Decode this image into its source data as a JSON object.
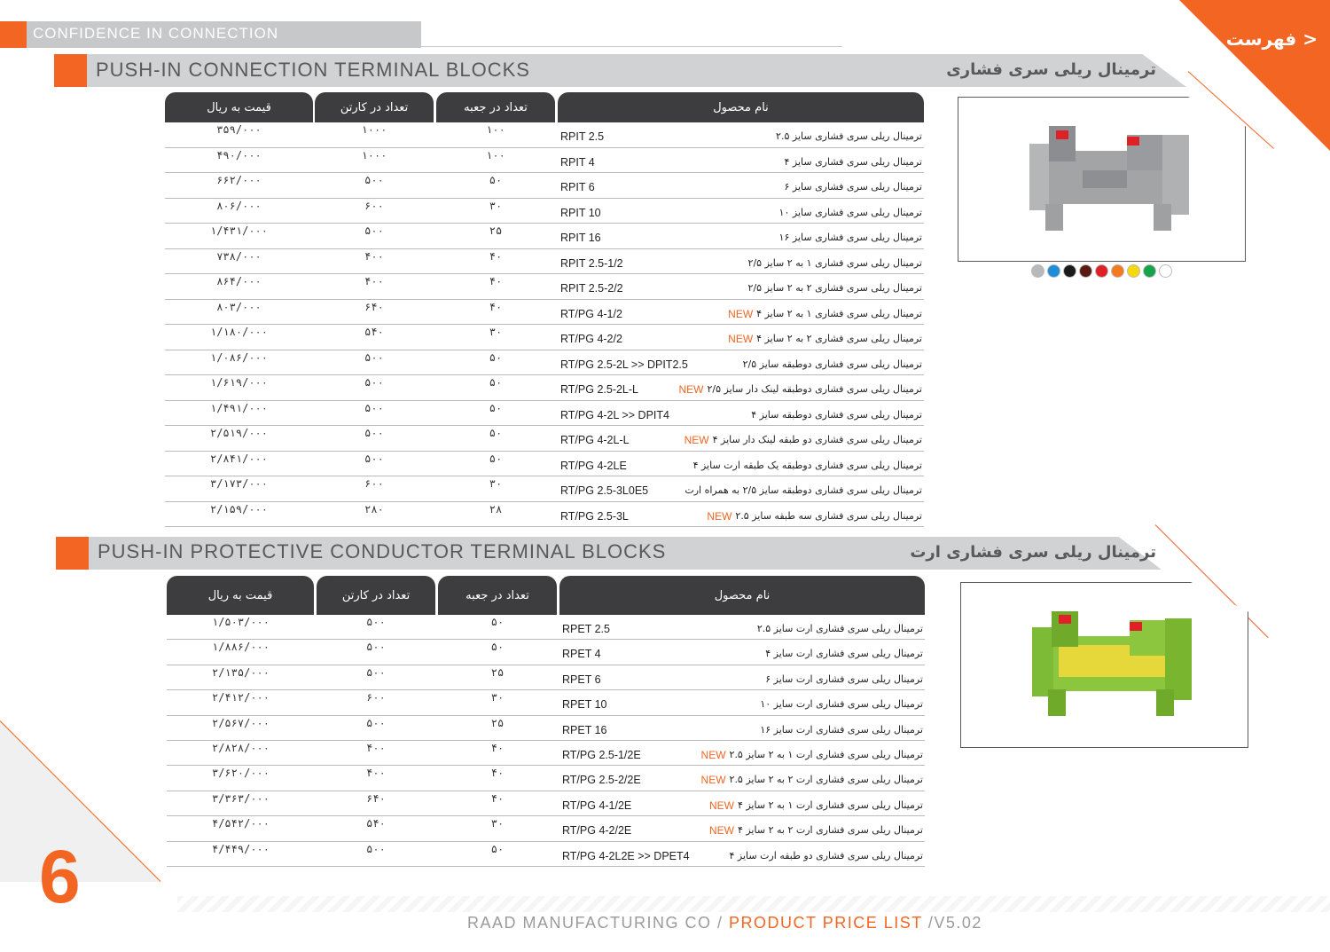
{
  "header": {
    "tagline": "CONFIDENCE IN CONNECTION",
    "menu_link": "< فهرست"
  },
  "section1": {
    "title_en": "PUSH-IN CONNECTION TERMINAL BLOCKS",
    "title_fa": "ترمینال ریلی سری فشاری",
    "columns": {
      "price": "قیمت به ریال",
      "carton": "تعداد در کارتن",
      "box": "تعداد در جعبه",
      "name": "نام محصول"
    },
    "rows": [
      {
        "price": "۳۵۹/۰۰۰",
        "carton": "۱۰۰۰",
        "box": "۱۰۰",
        "model": "RPIT  2.5",
        "name": "ترمینال ریلی سری فشاری سایز ۲.۵",
        "new": ""
      },
      {
        "price": "۴۹۰/۰۰۰",
        "carton": "۱۰۰۰",
        "box": "۱۰۰",
        "model": "RPIT  4",
        "name": "ترمینال ریلی سری فشاری سایز ۴",
        "new": ""
      },
      {
        "price": "۶۶۲/۰۰۰",
        "carton": "۵۰۰",
        "box": "۵۰",
        "model": "RPIT  6",
        "name": "ترمینال ریلی سری فشاری سایز ۶",
        "new": ""
      },
      {
        "price": "۸۰۶/۰۰۰",
        "carton": "۶۰۰",
        "box": "۳۰",
        "model": "RPIT 10",
        "name": "ترمینال ریلی سری فشاری سایز ۱۰",
        "new": ""
      },
      {
        "price": "۱/۴۳۱/۰۰۰",
        "carton": "۵۰۰",
        "box": "۲۵",
        "model": "RPIT  16",
        "name": "ترمینال ریلی سری فشاری سایز ۱۶",
        "new": ""
      },
      {
        "price": "۷۳۸/۰۰۰",
        "carton": "۴۰۰",
        "box": "۴۰",
        "model": "RPIT  2.5-1/2",
        "name": "ترمینال ریلی سری فشاری ۱ به ۲ سایز ۲/۵",
        "new": ""
      },
      {
        "price": "۸۶۴/۰۰۰",
        "carton": "۴۰۰",
        "box": "۴۰",
        "model": "RPIT  2.5-2/2",
        "name": "ترمینال ریلی سری فشاری ۲ به ۲ سایز ۲/۵",
        "new": ""
      },
      {
        "price": "۸۰۳/۰۰۰",
        "carton": "۶۴۰",
        "box": "۴۰",
        "model": "RT/PG  4-1/2",
        "name": "ترمینال ریلی سری فشاری ۱ به ۲ سایز ۴",
        "new": "NEW"
      },
      {
        "price": "۱/۱۸۰/۰۰۰",
        "carton": "۵۴۰",
        "box": "۳۰",
        "model": "RT/PG  4-2/2",
        "name": "ترمینال ریلی سری فشاری ۲ به ۲ سایز ۴",
        "new": "NEW"
      },
      {
        "price": "۱/۰۸۶/۰۰۰",
        "carton": "۵۰۰",
        "box": "۵۰",
        "model": "RT/PG 2.5-2L  >> DPIT2.5",
        "name": "ترمینال ریلی سری فشاری دوطبقه سایز ۲/۵",
        "new": ""
      },
      {
        "price": "۱/۶۱۹/۰۰۰",
        "carton": "۵۰۰",
        "box": "۵۰",
        "model": "RT/PG 2.5-2L-L",
        "name": "ترمینال ریلی سری فشاری دوطبقه لینک دار سایز ۲/۵",
        "new": "NEW"
      },
      {
        "price": "۱/۴۹۱/۰۰۰",
        "carton": "۵۰۰",
        "box": "۵۰",
        "model": "RT/PG 4-2L  >> DPIT4",
        "name": "ترمینال ریلی سری فشاری دوطبقه سایز ۴",
        "new": ""
      },
      {
        "price": "۲/۵۱۹/۰۰۰",
        "carton": "۵۰۰",
        "box": "۵۰",
        "model": "RT/PG  4-2L-L",
        "name": "ترمینال ریلی سری فشاری  دو طبقه لینک دار سایز ۴",
        "new": "NEW"
      },
      {
        "price": "۲/۸۴۱/۰۰۰",
        "carton": "۵۰۰",
        "box": "۵۰",
        "model": "RT/PG 4-2LE",
        "name": "ترمینال ریلی سری فشاری دوطبقه یک طبقه ارت سایز ۴",
        "new": ""
      },
      {
        "price": "۳/۱۷۳/۰۰۰",
        "carton": "۶۰۰",
        "box": "۳۰",
        "model": "RT/PG 2.5-3L0E5",
        "name": "ترمینال ریلی سری فشاری دوطبقه سایز ۲/۵ به همراه ارت",
        "new": ""
      },
      {
        "price": "۲/۱۵۹/۰۰۰",
        "carton": "۲۸۰",
        "box": "۲۸",
        "model": "RT/PG 2.5-3L",
        "name": "ترمینال ریلی سری فشاری سه طبقه سایز ۲.۵",
        "new": "NEW"
      }
    ],
    "image_alt": "grey push-in terminal block",
    "colors": [
      "#b8b9bb",
      "#1e8fd6",
      "#1a1a1a",
      "#5a1a12",
      "#e02027",
      "#f47a20",
      "#f5d90a",
      "#16a34a",
      "#ffffff"
    ]
  },
  "section2": {
    "title_en": "PUSH-IN PROTECTIVE CONDUCTOR TERMINAL BLOCKS",
    "title_fa": "ترمینال ریلی سری فشاری ارت",
    "columns": {
      "price": "قیمت به ریال",
      "carton": "تعداد در کارتن",
      "box": "تعداد در جعبه",
      "name": "نام محصول"
    },
    "rows": [
      {
        "price": "۱/۵۰۳/۰۰۰",
        "carton": "۵۰۰",
        "box": "۵۰",
        "model": "RPET  2.5",
        "name": "ترمینال ریلی سری فشاری ارت سایز ۲.۵",
        "new": ""
      },
      {
        "price": "۱/۸۸۶/۰۰۰",
        "carton": "۵۰۰",
        "box": "۵۰",
        "model": "RPET  4",
        "name": "ترمینال ریلی سری فشاری ارت سایز ۴",
        "new": ""
      },
      {
        "price": "۲/۱۳۵/۰۰۰",
        "carton": "۵۰۰",
        "box": "۲۵",
        "model": "RPET  6",
        "name": "ترمینال ریلی سری فشاری ارت سایز ۶",
        "new": ""
      },
      {
        "price": "۲/۴۱۲/۰۰۰",
        "carton": "۶۰۰",
        "box": "۳۰",
        "model": "RPET  10",
        "name": "ترمینال ریلی سری فشاری ارت سایز ۱۰",
        "new": ""
      },
      {
        "price": "۲/۵۶۷/۰۰۰",
        "carton": "۵۰۰",
        "box": "۲۵",
        "model": "RPET  16",
        "name": "ترمینال ریلی سری فشاری ارت سایز ۱۶",
        "new": ""
      },
      {
        "price": "۲/۸۲۸/۰۰۰",
        "carton": "۴۰۰",
        "box": "۴۰",
        "model": "RT/PG  2.5-1/2E",
        "name": "ترمینال ریلی سری فشاری ارت ۱ به ۲ سایز ۲.۵",
        "new": "NEW"
      },
      {
        "price": "۳/۶۲۰/۰۰۰",
        "carton": "۴۰۰",
        "box": "۴۰",
        "model": "RT/PG  2.5-2/2E",
        "name": "ترمینال ریلی سری فشاری ارت ۲ به ۲ سایز ۲.۵",
        "new": "NEW"
      },
      {
        "price": "۳/۳۶۳/۰۰۰",
        "carton": "۶۴۰",
        "box": "۴۰",
        "model": "RT/PG  4-1/2E",
        "name": "ترمینال ریلی سری فشاری ارت ۱ به ۲ سایز ۴",
        "new": "NEW"
      },
      {
        "price": "۴/۵۴۲/۰۰۰",
        "carton": "۵۴۰",
        "box": "۳۰",
        "model": "RT/PG  4-2/2E",
        "name": "ترمینال ریلی سری فشاری ارت ۲ به ۲ سایز ۴",
        "new": "NEW"
      },
      {
        "price": "۴/۴۴۹/۰۰۰",
        "carton": "۵۰۰",
        "box": "۵۰",
        "model": "RT/PG 4-2L2E  >> DPET4",
        "name": "ترمینال ریلی سری فشاری دو طبقه ارت سایز ۴",
        "new": ""
      }
    ],
    "image_alt": "green-yellow protective conductor push-in terminal block"
  },
  "footer": {
    "page_number": "6",
    "company": "RAAD MANUFACTURING CO / ",
    "list_label": "PRODUCT PRICE LIST",
    "version": " /V5.02"
  }
}
